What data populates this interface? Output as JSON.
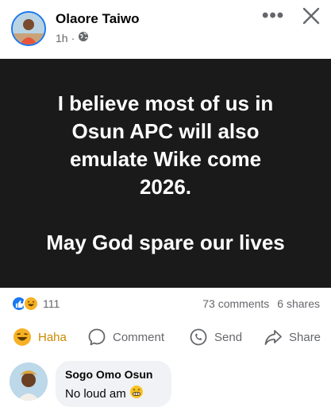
{
  "post": {
    "author": "Olaore Taiwo",
    "time": "1h",
    "separator": "·",
    "more_label": "•••",
    "body_lines": [
      "I believe most of us in",
      "Osun APC will also",
      "emulate Wike come",
      "2026.",
      "",
      "May God spare our lives"
    ],
    "background_color": "#1a1a1a",
    "text_color": "#ffffff"
  },
  "stats": {
    "reaction_count": "111",
    "comments": "73 comments",
    "shares": "6 shares",
    "reaction_icons": [
      "like-icon",
      "haha-icon"
    ]
  },
  "actions": [
    {
      "label": "Haha",
      "icon": "haha-icon"
    },
    {
      "label": "Comment",
      "icon": "comment-icon"
    },
    {
      "label": "Send",
      "icon": "send-icon"
    },
    {
      "label": "Share",
      "icon": "share-icon"
    }
  ],
  "comment": {
    "author": "Sogo Omo Osun",
    "text": "No loud am"
  },
  "colors": {
    "accent": "#1877f2",
    "muted": "#65676b",
    "bubble": "#f0f2f5",
    "haha": "#f7b125"
  }
}
